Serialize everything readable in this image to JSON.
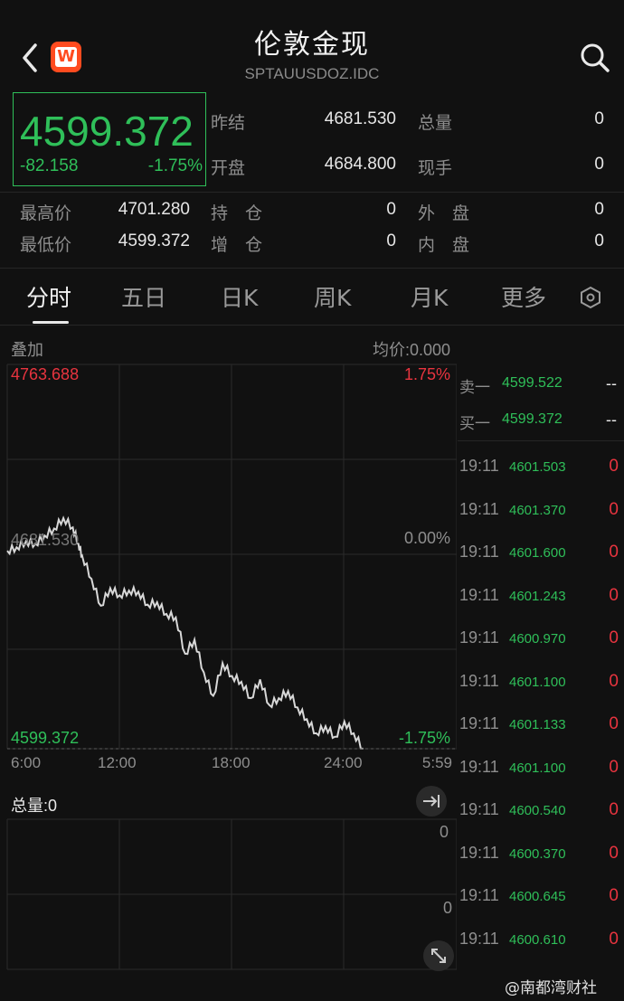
{
  "header": {
    "title": "伦敦金现",
    "subtitle": "SPTAUUSDOZ.IDC",
    "logo_letter": "W"
  },
  "quote": {
    "price": "4599.372",
    "change": "-82.158",
    "change_pct": "-1.75%",
    "stats": {
      "prev_settle_label": "昨结",
      "prev_settle": "4681.530",
      "volume_label": "总量",
      "volume": "0",
      "open_label": "开盘",
      "open": "4684.800",
      "current_hand_label": "现手",
      "current_hand": "0",
      "high_label": "最高价",
      "high": "4701.280",
      "position_label": "持　仓",
      "position": "0",
      "outer_label": "外　盘",
      "outer": "0",
      "low_label": "最低价",
      "low": "4599.372",
      "increase_label": "增　仓",
      "increase": "0",
      "inner_label": "内　盘",
      "inner": "0"
    }
  },
  "tabs": [
    {
      "label": "分时",
      "active": true
    },
    {
      "label": "五日",
      "active": false
    },
    {
      "label": "日K",
      "active": false
    },
    {
      "label": "周K",
      "active": false
    },
    {
      "label": "月K",
      "active": false
    },
    {
      "label": "更多",
      "active": false
    }
  ],
  "chart_header": {
    "overlay_label": "叠加",
    "avg_price_label": "均价:0.000"
  },
  "chart_data": {
    "type": "line",
    "y_max_label": "4763.688",
    "y_mid_label": "4681.530",
    "y_min_label": "4599.372",
    "pct_top": "1.75%",
    "pct_mid": "0.00%",
    "pct_bottom": "-1.75%",
    "ylim": [
      4599.372,
      4763.688
    ],
    "x_ticks": [
      "6:00",
      "12:00",
      "18:00",
      "24:00",
      "5:59"
    ],
    "series": [
      {
        "x_hours": [
          0,
          0.5,
          1,
          1.5,
          2,
          2.5,
          3,
          3.5,
          3.8,
          4,
          4.5,
          5,
          5.5,
          6,
          6.5,
          7,
          7.5,
          8,
          8.5,
          9,
          9.5,
          10,
          10.5,
          11,
          11.5,
          12,
          12.5,
          13,
          13.5,
          14,
          14.5,
          15,
          15.5,
          16,
          16.5,
          17,
          17.5,
          18,
          18.5,
          19
        ],
        "values": [
          4684.0,
          4685.5,
          4688.0,
          4687.0,
          4690.5,
          4693.5,
          4698.0,
          4694.0,
          4687.0,
          4682.0,
          4672.0,
          4660.5,
          4668.0,
          4665.0,
          4667.0,
          4666.5,
          4661.0,
          4662.0,
          4657.0,
          4655.5,
          4640.0,
          4646.0,
          4632.0,
          4622.0,
          4636.0,
          4630.5,
          4628.0,
          4621.0,
          4629.0,
          4618.0,
          4621.0,
          4624.0,
          4617.0,
          4612.0,
          4606.0,
          4609.0,
          4604.5,
          4611.0,
          4606.0,
          4599.4
        ]
      }
    ],
    "volume_panel": {
      "label": "总量:0",
      "top_value": "0",
      "mid_value": "0"
    }
  },
  "order_book": {
    "ask1_label": "卖一",
    "ask1_price": "4599.522",
    "ask1_vol": "--",
    "bid1_label": "买一",
    "bid1_price": "4599.372",
    "bid1_vol": "--"
  },
  "ticks": [
    {
      "time": "19:11",
      "price": "4601.503",
      "vol": "0"
    },
    {
      "time": "19:11",
      "price": "4601.370",
      "vol": "0"
    },
    {
      "time": "19:11",
      "price": "4601.600",
      "vol": "0"
    },
    {
      "time": "19:11",
      "price": "4601.243",
      "vol": "0"
    },
    {
      "time": "19:11",
      "price": "4600.970",
      "vol": "0"
    },
    {
      "time": "19:11",
      "price": "4601.100",
      "vol": "0"
    },
    {
      "time": "19:11",
      "price": "4601.133",
      "vol": "0"
    },
    {
      "time": "19:11",
      "price": "4601.100",
      "vol": "0"
    },
    {
      "time": "19:11",
      "price": "4600.540",
      "vol": "0"
    },
    {
      "time": "19:11",
      "price": "4600.370",
      "vol": "0"
    },
    {
      "time": "19:11",
      "price": "4600.645",
      "vol": "0"
    },
    {
      "time": "19:11",
      "price": "4600.610",
      "vol": "0"
    }
  ],
  "watermark": "@南都湾财社",
  "colors": {
    "up": "#e8343f",
    "down": "#2fbf59",
    "background": "#111111"
  }
}
